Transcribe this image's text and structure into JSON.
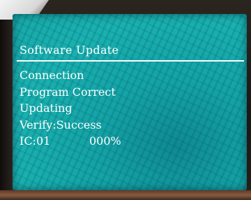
{
  "screen": {
    "title": "Software Update",
    "status_lines": [
      "Connection",
      "Program Correct",
      "Updating",
      "Verify:Success"
    ],
    "ic": {
      "label": "IC:01",
      "progress": "000%"
    },
    "colors": {
      "background": "#17aaa9",
      "text": "#ffffff"
    }
  }
}
